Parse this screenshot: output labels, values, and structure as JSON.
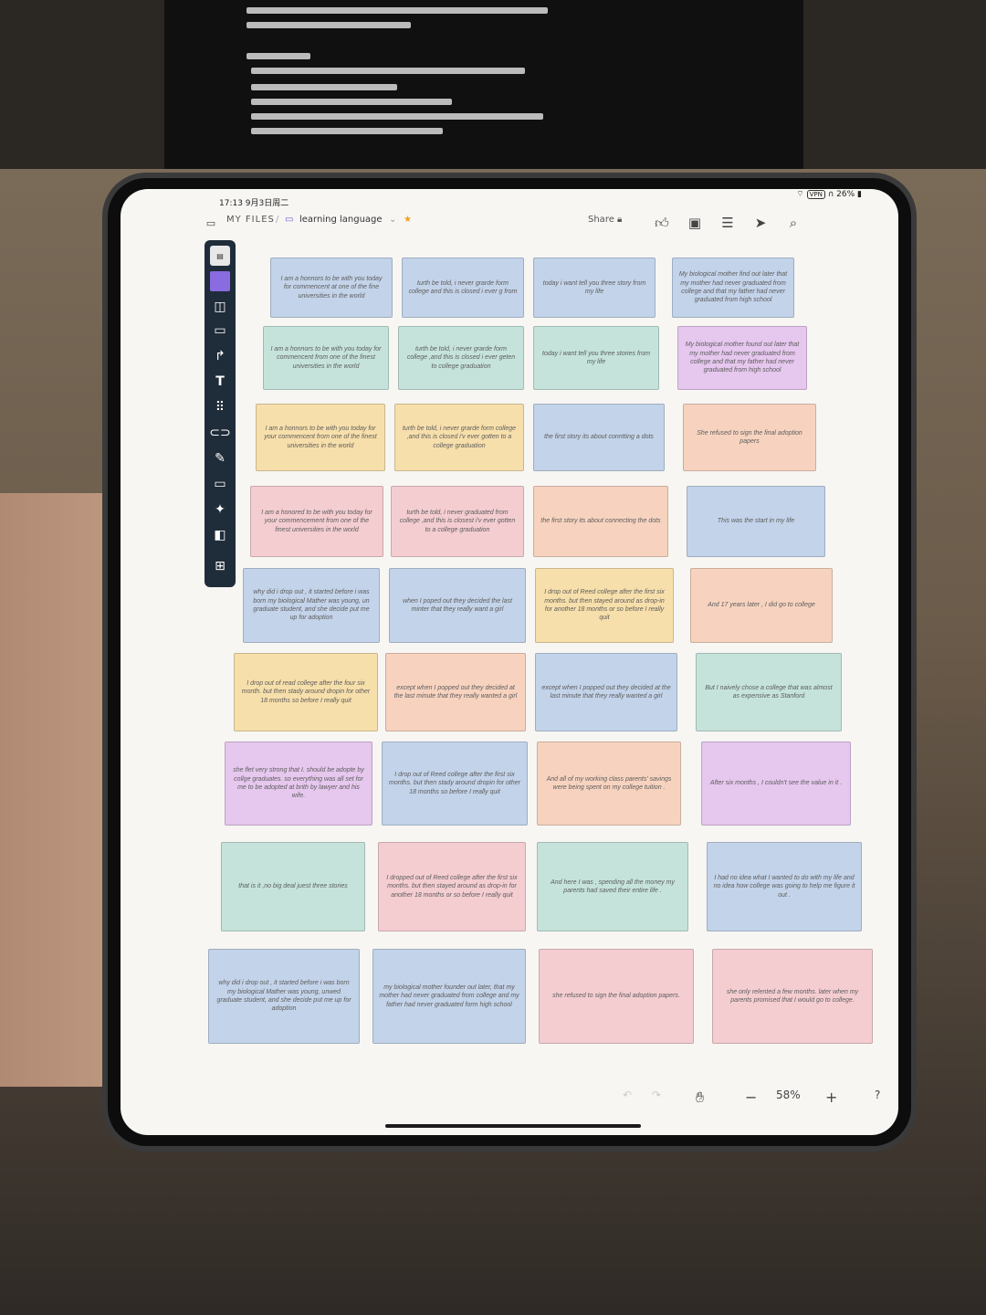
{
  "status": {
    "time": "17:13  9月3日周二",
    "battery": "26%",
    "vpn": "VPN"
  },
  "topbar": {
    "files_label": "MY FILES",
    "separator": "/",
    "board_title": "learning language",
    "share_label": "Share"
  },
  "zoom": {
    "level": "58%",
    "minus": "−",
    "plus": "+"
  },
  "help_label": "?",
  "colors": {
    "blue": "#c3d3e9",
    "teal": "#c5e3db",
    "yellow": "#f7dfab",
    "pink": "#f4cdd1",
    "purple": "#e6c7ee",
    "peach": "#f7d3bf",
    "toolbar": "#1f2c3a"
  },
  "icons": [
    "sidebar-toggle-icon",
    "board-icon",
    "chevron-down-icon",
    "star-icon",
    "lock-icon",
    "thumbs-up-icon",
    "present-icon",
    "comment-icon",
    "send-icon",
    "search-icon",
    "arrow-icon",
    "text-icon",
    "grid-icon",
    "link-icon",
    "pen-icon",
    "frame-icon",
    "magic-icon",
    "layout-icon",
    "add-icon",
    "undo-icon",
    "redo-icon",
    "hand-icon"
  ],
  "cards": [
    {
      "text": "I am a honnors to be with you today for commencent at one of the fine universities in the world",
      "color": "blue"
    },
    {
      "text": "turth be told, i never grarde form college and this is closed i ever g from",
      "color": "blue"
    },
    {
      "text": "today i want tell you three story from my life",
      "color": "blue"
    },
    {
      "text": "My biological mother find out later that my mother had never graduated from college and that my father had never graduated from high school",
      "color": "blue"
    },
    {
      "text": "I am a honnors to be with you today for commencent from one of the finest universities in the world",
      "color": "teal"
    },
    {
      "text": "turth be told, i never grarde form college ,and this is closed i ever geten to college graduation",
      "color": "teal"
    },
    {
      "text": "today i want tell you three stories from my life",
      "color": "teal"
    },
    {
      "text": "My biological mother found out later that my mother had never graduated from college and that my father had never graduated from high school",
      "color": "purple"
    },
    {
      "text": "I am a honnors to be with you today for your commencent from one of the finest universities in the world",
      "color": "yellow"
    },
    {
      "text": "turth be told, i never grarde form college ,and this is closed i'v ever gotten to a college graduation",
      "color": "yellow"
    },
    {
      "text": "the first story its about conntting a dots",
      "color": "blue"
    },
    {
      "text": "She refused to sign the final adoption papers",
      "color": "peach"
    },
    {
      "text": "I am a honored to be with you today for your commencement from one of the finest universities in the world",
      "color": "pink"
    },
    {
      "text": "turth be told, i never graduated from college ,and this is closest i'v ever gotten to a college graduation",
      "color": "pink"
    },
    {
      "text": "the first story its about connecting the dots",
      "color": "peach"
    },
    {
      "text": "This was the start in my life",
      "color": "blue"
    },
    {
      "text": "why did i drop out , it started before i was born my biological Mather was young, un graduate student, and she decide put me up for adoption",
      "color": "blue"
    },
    {
      "text": "when I poped out they decided the last minter that they really want a girl",
      "color": "blue"
    },
    {
      "text": "I drop out of Reed college after the first six months. but then stayed around as drop-in for another 18 months or so before I really quit",
      "color": "yellow"
    },
    {
      "text": "And 17 years later , I did go to college",
      "color": "peach"
    },
    {
      "text": "I drop out of read college after the four six month. but then stady around dropin for other 18 months so before I really quit",
      "color": "yellow"
    },
    {
      "text": "except when I popped out they decided at the last minute that they really wanted a girl",
      "color": "peach"
    },
    {
      "text": "except when I popped out they decided at the last minute that they really wanted a girl",
      "color": "blue"
    },
    {
      "text": "But I naively chose a college that was almost as expensive as Stanford",
      "color": "teal"
    },
    {
      "text": "she flet very strong that I. should be adopte by collge graduates. so everything was all set for me to be adopted at brith by lawyer and his wife.",
      "color": "purple"
    },
    {
      "text": "I drop out of Reed college after the first six months. but then stady around dropin for other 18 months so before I really quit",
      "color": "blue"
    },
    {
      "text": "And all of my working class parents' savings were being spent on my college tuition .",
      "color": "peach"
    },
    {
      "text": "After six months , I couldn't see the value in it .",
      "color": "purple"
    },
    {
      "text": "that is it ,no big deal juest three stories",
      "color": "teal"
    },
    {
      "text": "I dropped out of Reed college after the first six months. but then stayed around as drop-in for another 18 months or so before I really quit",
      "color": "pink"
    },
    {
      "text": "And here I was , spending all the money my parents had saved their entire life .",
      "color": "teal"
    },
    {
      "text": "I had no idea what I wanted to do with my life and no idea how college was going to help me figure it out .",
      "color": "blue"
    },
    {
      "text": "why did i drop out , it started before i was born my biological Mather was young, unwed graduate student, and she decide put me up for adoption",
      "color": "blue"
    },
    {
      "text": "my biological mother founder out later, that my mother had never graduated from college and my father had never graduated form high school",
      "color": "blue"
    },
    {
      "text": "she refused to sign the final adoption papers.",
      "color": "pink"
    },
    {
      "text": "she only relented a few months. later when my parents promised that I would go to college.",
      "color": "pink"
    }
  ]
}
